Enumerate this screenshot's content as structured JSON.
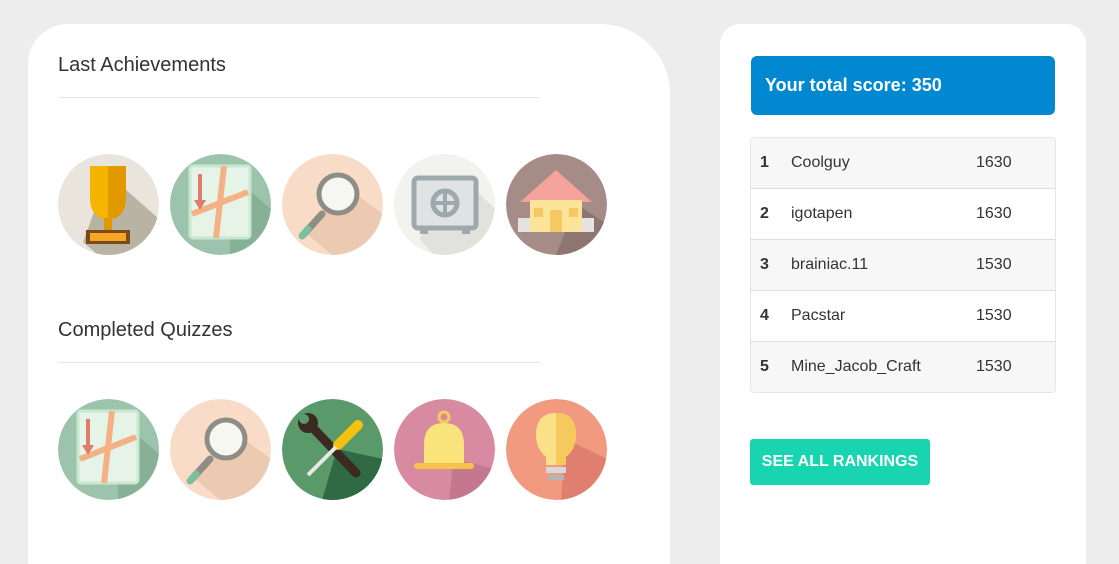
{
  "achievements": {
    "title": "Last Achievements",
    "badges": [
      "trophy-icon",
      "map-icon",
      "magnifier-icon",
      "safe-icon",
      "house-icon"
    ]
  },
  "quizzes": {
    "title": "Completed Quizzes",
    "badges": [
      "map-icon",
      "magnifier-icon",
      "tools-icon",
      "bell-icon",
      "lightbulb-icon"
    ]
  },
  "score": {
    "label": "Your total score: 350"
  },
  "rankings": [
    {
      "rank": "1",
      "name": "Coolguy",
      "score": "1630"
    },
    {
      "rank": "2",
      "name": "igotapen",
      "score": "1630"
    },
    {
      "rank": "3",
      "name": "brainiac.11",
      "score": "1530"
    },
    {
      "rank": "4",
      "name": "Pacstar",
      "score": "1530"
    },
    {
      "rank": "5",
      "name": "Mine_Jacob_Craft",
      "score": "1530"
    }
  ],
  "see_all": {
    "label": "SEE ALL RANKINGS"
  },
  "colors": {
    "score_bg": "#0288d1",
    "button_bg": "#18d4b0"
  }
}
